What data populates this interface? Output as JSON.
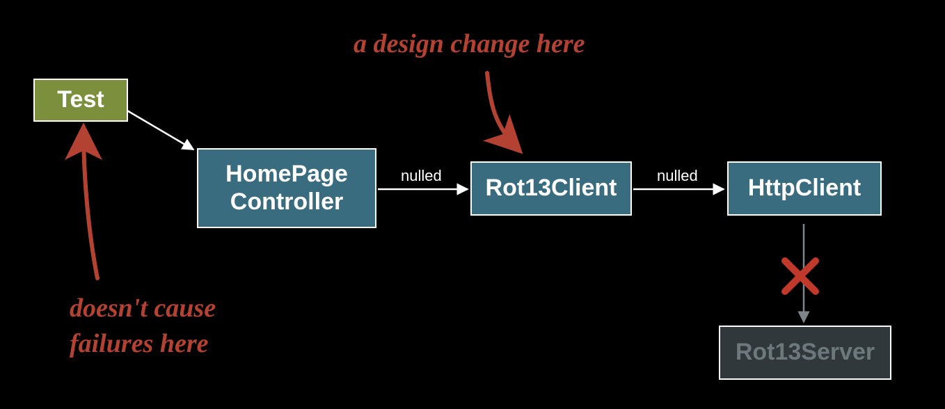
{
  "nodes": {
    "test": {
      "label": "Test"
    },
    "controller": {
      "label": "HomePage\nController"
    },
    "rot13client": {
      "label": "Rot13Client"
    },
    "httpclient": {
      "label": "HttpClient"
    },
    "rot13server": {
      "label": "Rot13Server"
    }
  },
  "edges": {
    "test_to_controller": {
      "label": ""
    },
    "controller_to_rot13client": {
      "label": "nulled"
    },
    "rot13client_to_httpclient": {
      "label": "nulled"
    },
    "httpclient_to_rot13server": {
      "label": "",
      "blocked": true
    }
  },
  "annotations": {
    "top": {
      "text": "a design change here"
    },
    "bottom": {
      "text": "doesn't cause\nfailures here"
    }
  },
  "colors": {
    "test_bg": "#7b8f3d",
    "blue_bg": "#3a6c80",
    "gray_bg": "#30383b",
    "annot": "#b44232",
    "stroke": "#ffffff"
  }
}
